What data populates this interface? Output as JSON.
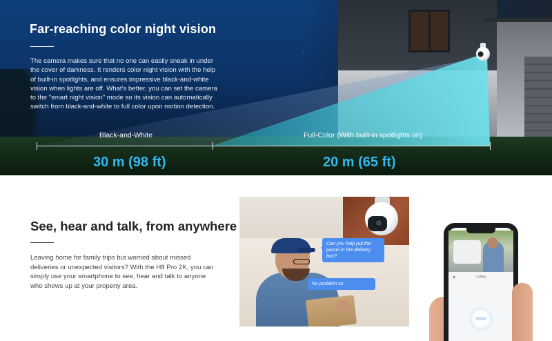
{
  "night_vision": {
    "title": "Far-reaching color night vision",
    "body": "The camera makes sure that no one can easily sneak in under the cover of darkness. It renders color night vision with the help of built-in spotlights, and ensures impressive black-and-white vision when lights are off. What's better, you can set the camera to the \"smart night vision\" mode so its vision can automatically switch from black-and-white to full color upon motion detection.",
    "bw_label": "Black-and-White",
    "fc_label": "Full-Color (With built-in spotlights on)",
    "bw_distance": "30 m (98 ft)",
    "fc_distance": "20 m (65 ft)",
    "accent_color": "#33b7f0",
    "beam_color": "#5ad2e0"
  },
  "talk": {
    "title": "See, hear and talk, from anywhere",
    "body": "Leaving home for family trips but worried about missed deliveries or unexpected visitors? With the H8 Pro 2K, you can simply use your smartphone to see, hear and talk to anyone who shows up at your property area.",
    "bubble_question": "Can you help put the parcel in the delivery box?",
    "bubble_answer": "No problem sir.",
    "phone_status": "Calling",
    "phone_close_icon": "close-icon",
    "bubble_color": "#4b8ef0"
  }
}
